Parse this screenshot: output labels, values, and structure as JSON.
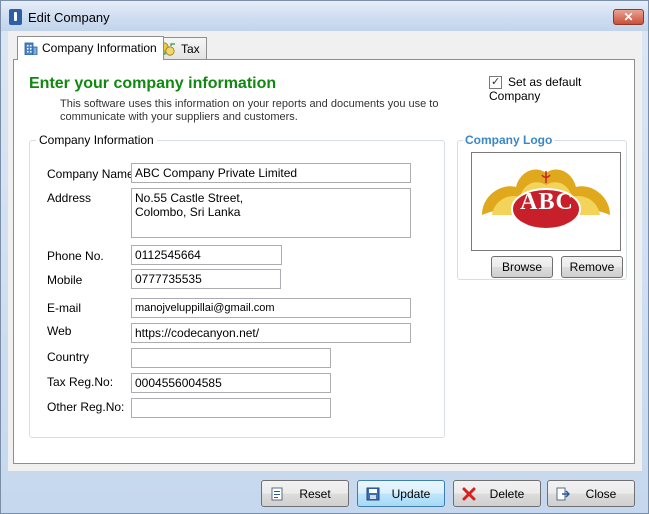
{
  "window": {
    "title": "Edit Company",
    "close_glyph": "✕"
  },
  "tabs": [
    {
      "label": "Company Information",
      "icon": "building-icon",
      "active": true
    },
    {
      "label": "Tax",
      "icon": "coins-icon",
      "active": false
    }
  ],
  "header": {
    "title": "Enter your company information",
    "description": "This software uses this information on your reports and documents you use to communicate with your suppliers and customers.",
    "default_checkbox": {
      "label": "Set as default Company",
      "checked": true
    }
  },
  "company_info": {
    "group_title": "Company Information",
    "fields": {
      "company_name": {
        "label": "Company Name",
        "value": "ABC Company Private Limited"
      },
      "address": {
        "label": "Address",
        "value": "No.55 Castle Street,\nColombo, Sri Lanka"
      },
      "phone": {
        "label": "Phone No.",
        "value": "0112545664"
      },
      "mobile": {
        "label": "Mobile",
        "value": "0777735535"
      },
      "email": {
        "label": "E-mail",
        "value": "manojveluppillai@gmail.com"
      },
      "web": {
        "label": "Web",
        "value": "https://codecanyon.net/"
      },
      "country": {
        "label": "Country",
        "value": ""
      },
      "tax_reg": {
        "label": "Tax Reg.No:",
        "value": "0004556004585"
      },
      "other_reg": {
        "label": "Other Reg.No:",
        "value": ""
      }
    }
  },
  "logo": {
    "group_title": "Company Logo",
    "logo_text": "ABC",
    "browse_label": "Browse",
    "remove_label": "Remove"
  },
  "footer": {
    "reset_label": "Reset",
    "update_label": "Update",
    "delete_label": "Delete",
    "close_label": "Close"
  },
  "colors": {
    "heading": "#118811",
    "logo_title": "#3a87c8",
    "logo_red": "#c8202a",
    "logo_gold": "#e0a81c"
  }
}
